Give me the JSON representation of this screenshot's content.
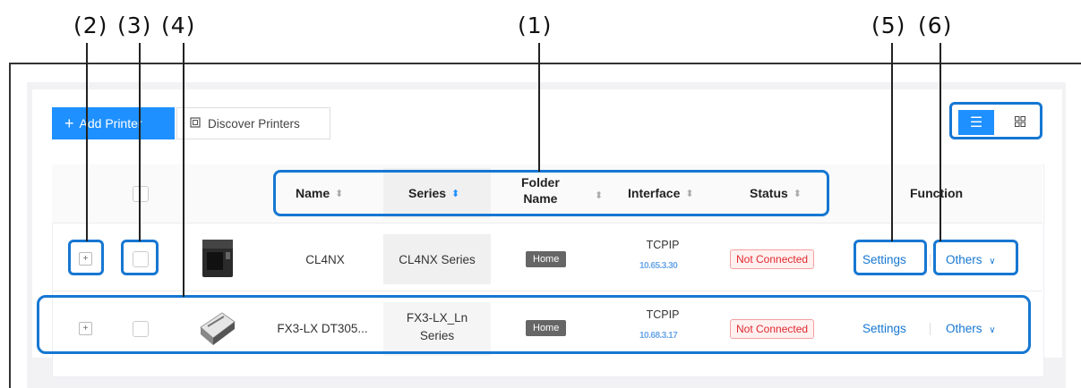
{
  "callouts": {
    "c1": "(1)",
    "c2": "(2)",
    "c3": "(3)",
    "c4": "(4)",
    "c5": "(5)",
    "c6": "(6)"
  },
  "toolbar": {
    "add_label": "Add Printer",
    "discover_label": "Discover Printers"
  },
  "table": {
    "headers": {
      "name": "Name",
      "series": "Series",
      "folder_line1": "Folder",
      "folder_line2": "Name",
      "interface": "Interface",
      "status": "Status",
      "function": "Function"
    },
    "rows": [
      {
        "name": "CL4NX",
        "series": "CL4NX Series",
        "series_line2": "",
        "folder": "Home",
        "interface": "TCPIP",
        "ip": "10.65.3.30",
        "status": "Not Connected",
        "settings": "Settings",
        "others": "Others"
      },
      {
        "name": "FX3-LX DT305...",
        "series": "FX3-LX_Ln",
        "series_line2": "Series",
        "folder": "Home",
        "interface": "TCPIP",
        "ip": "10.68.3.17",
        "status": "Not Connected",
        "settings": "Settings",
        "others": "Others"
      }
    ]
  },
  "colors": {
    "accent": "#1e90ff",
    "highlight": "#1677d2",
    "error": "#e0282e"
  }
}
